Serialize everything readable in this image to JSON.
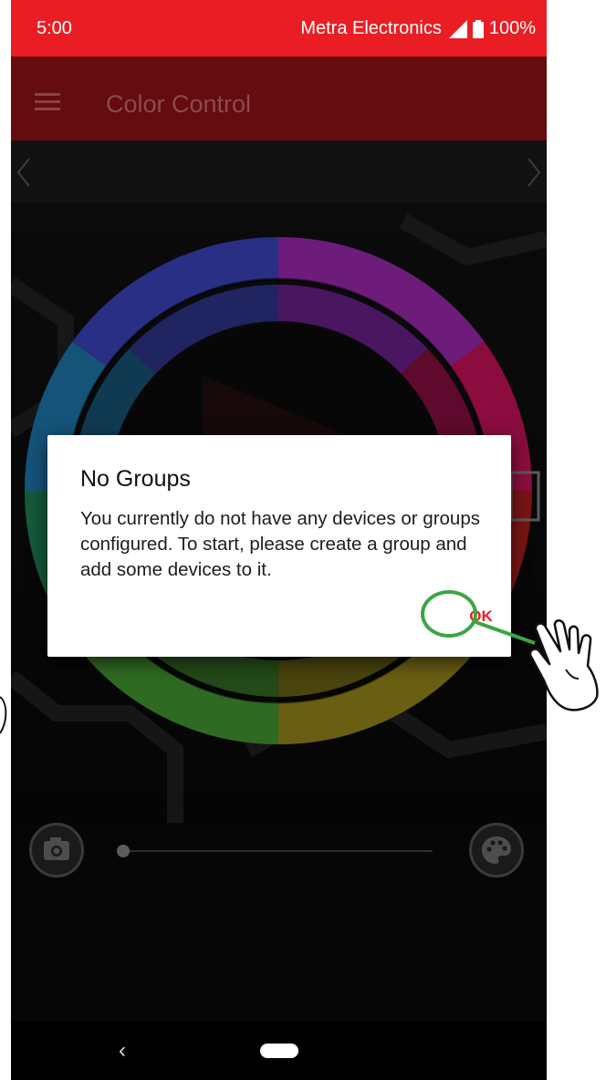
{
  "status_bar": {
    "time": "5:00",
    "carrier": "Metra Electronics",
    "battery": "100%",
    "background": "#ea1d24"
  },
  "app_bar": {
    "title": "Color Control",
    "menu_icon": "hamburger-menu-icon",
    "background": "#650c0e"
  },
  "nav": {
    "prev_icon": "chevron-left-icon",
    "next_icon": "chevron-right-icon"
  },
  "color_wheel": {
    "segments": [
      "blue",
      "indigo",
      "violet",
      "magenta",
      "red",
      "orange",
      "yellow",
      "chartreuse",
      "green",
      "teal"
    ]
  },
  "controls": {
    "camera_icon": "camera-icon",
    "palette_icon": "palette-icon",
    "slider_value": 0
  },
  "dialog": {
    "title": "No Groups",
    "message": "You currently do not have any devices or groups configured. To start, please create a group and add some devices to it.",
    "ok_label": "OK"
  },
  "annotation": {
    "highlight_color": "#3ba643",
    "pointer_icon": "hand-pointer-icon"
  },
  "system_nav": {
    "back_label": "‹",
    "home_icon": "home-pill-icon"
  }
}
